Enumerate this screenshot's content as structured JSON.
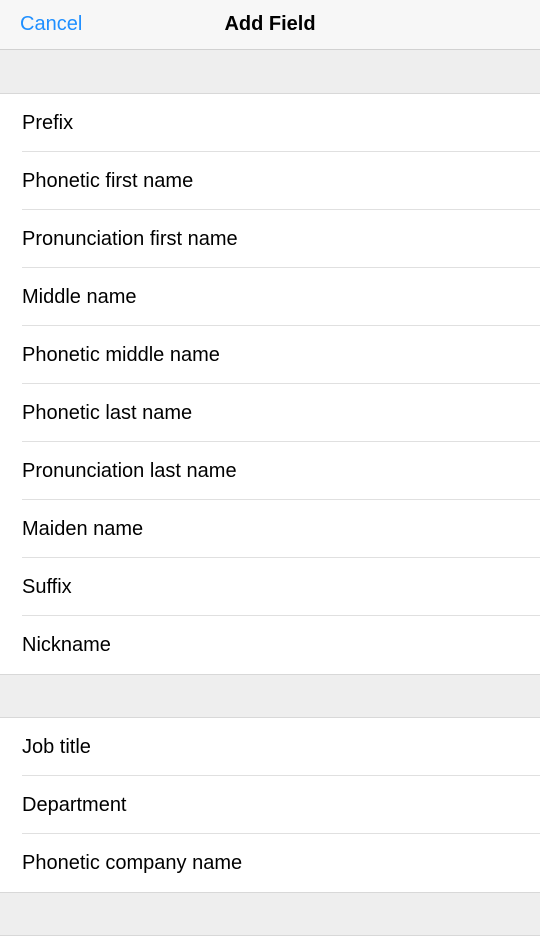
{
  "navbar": {
    "cancel": "Cancel",
    "title": "Add Field"
  },
  "section1": {
    "items": [
      {
        "label": "Prefix"
      },
      {
        "label": "Phonetic first name"
      },
      {
        "label": "Pronunciation first name"
      },
      {
        "label": "Middle name"
      },
      {
        "label": "Phonetic middle name"
      },
      {
        "label": "Phonetic last name"
      },
      {
        "label": "Pronunciation last name"
      },
      {
        "label": "Maiden name"
      },
      {
        "label": "Suffix"
      },
      {
        "label": "Nickname"
      }
    ]
  },
  "section2": {
    "items": [
      {
        "label": "Job title"
      },
      {
        "label": "Department"
      },
      {
        "label": "Phonetic company name"
      }
    ]
  }
}
